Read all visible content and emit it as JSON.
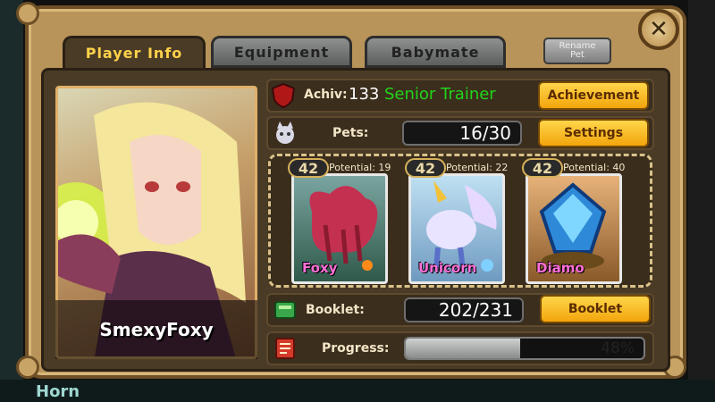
{
  "tabs": {
    "player_info": "Player Info",
    "equipment": "Equipment",
    "babymate": "Babymate"
  },
  "rename_pet": "Rename\nPet",
  "player": {
    "name": "SmexyFoxy"
  },
  "achievement": {
    "label": "Achiv:",
    "count": "133",
    "title": "Senior Trainer",
    "button": "Achievement"
  },
  "pets": {
    "label": "Pets:",
    "value": "16/30",
    "button": "Settings"
  },
  "pet_cards": [
    {
      "level": "42",
      "potential": "Potential: 19",
      "name": "Foxy"
    },
    {
      "level": "42",
      "potential": "Potential: 22",
      "name": "Unicorn"
    },
    {
      "level": "42",
      "potential": "Potential: 40",
      "name": "Diamo"
    }
  ],
  "booklet": {
    "label": "Booklet:",
    "value": "202/231",
    "button": "Booklet"
  },
  "progress": {
    "label": "Progress:",
    "text": "48%",
    "fraction": 0.48
  },
  "background_text": "Horn",
  "colors": {
    "gold": "#ffd24a",
    "achievement_title": "#22d31a",
    "pet_name": "#ff6fd8",
    "frame": "#b9945a"
  }
}
